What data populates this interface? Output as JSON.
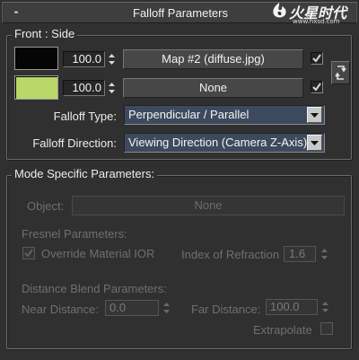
{
  "rollout": {
    "title": "Falloff Parameters",
    "collapse_symbol": "-"
  },
  "brand": {
    "name": "火星时代",
    "url": "www.hxsd.com"
  },
  "front_side": {
    "group_label": "Front : Side",
    "front": {
      "color": "#050505",
      "amount": "100.0",
      "map_label": "Map #2 (diffuse.jpg)",
      "enabled": true
    },
    "side": {
      "color": "#b9d867",
      "amount": "100.0",
      "map_label": "None",
      "enabled": true
    },
    "falloff_type_label": "Falloff Type:",
    "falloff_type_value": "Perpendicular / Parallel",
    "falloff_direction_label": "Falloff Direction:",
    "falloff_direction_value": "Viewing Direction (Camera Z-Axis)"
  },
  "mode_specific": {
    "group_label": "Mode Specific Parameters:",
    "object_label": "Object:",
    "object_value": "None",
    "fresnel_header": "Fresnel Parameters:",
    "override_ior_label": "Override Material IOR",
    "override_ior_checked": true,
    "ior_label": "Index of Refraction",
    "ior_value": "1.6",
    "distance_header": "Distance Blend Parameters:",
    "near_label": "Near Distance:",
    "near_value": "0.0",
    "far_label": "Far Distance:",
    "far_value": "100.0",
    "extrapolate_label": "Extrapolate",
    "extrapolate_checked": false
  },
  "colors": {
    "panel_bg": "#303030",
    "dropdown_bg": "#3d4a5e",
    "disabled_text": "#6f6f6f",
    "check_enabled": "#d8d8d8",
    "check_disabled": "#5e5e5e"
  }
}
